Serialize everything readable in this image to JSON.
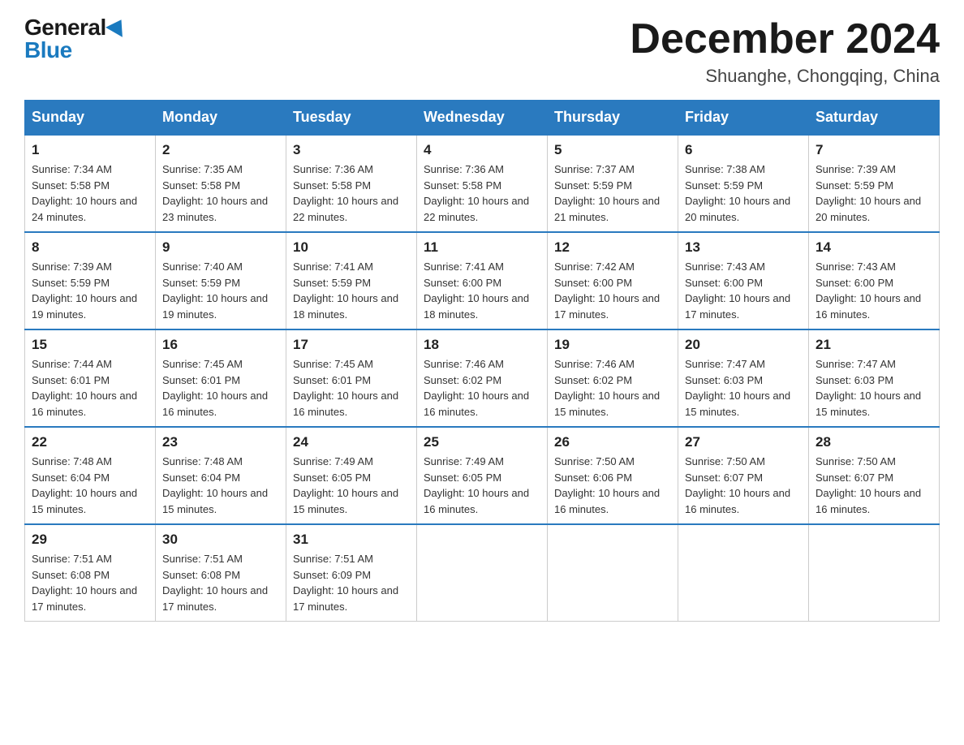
{
  "header": {
    "logo_general": "General",
    "logo_blue": "Blue",
    "month_title": "December 2024",
    "location": "Shuanghe, Chongqing, China"
  },
  "days_of_week": [
    "Sunday",
    "Monday",
    "Tuesday",
    "Wednesday",
    "Thursday",
    "Friday",
    "Saturday"
  ],
  "weeks": [
    [
      {
        "day": "1",
        "sunrise": "7:34 AM",
        "sunset": "5:58 PM",
        "daylight": "10 hours and 24 minutes."
      },
      {
        "day": "2",
        "sunrise": "7:35 AM",
        "sunset": "5:58 PM",
        "daylight": "10 hours and 23 minutes."
      },
      {
        "day": "3",
        "sunrise": "7:36 AM",
        "sunset": "5:58 PM",
        "daylight": "10 hours and 22 minutes."
      },
      {
        "day": "4",
        "sunrise": "7:36 AM",
        "sunset": "5:58 PM",
        "daylight": "10 hours and 22 minutes."
      },
      {
        "day": "5",
        "sunrise": "7:37 AM",
        "sunset": "5:59 PM",
        "daylight": "10 hours and 21 minutes."
      },
      {
        "day": "6",
        "sunrise": "7:38 AM",
        "sunset": "5:59 PM",
        "daylight": "10 hours and 20 minutes."
      },
      {
        "day": "7",
        "sunrise": "7:39 AM",
        "sunset": "5:59 PM",
        "daylight": "10 hours and 20 minutes."
      }
    ],
    [
      {
        "day": "8",
        "sunrise": "7:39 AM",
        "sunset": "5:59 PM",
        "daylight": "10 hours and 19 minutes."
      },
      {
        "day": "9",
        "sunrise": "7:40 AM",
        "sunset": "5:59 PM",
        "daylight": "10 hours and 19 minutes."
      },
      {
        "day": "10",
        "sunrise": "7:41 AM",
        "sunset": "5:59 PM",
        "daylight": "10 hours and 18 minutes."
      },
      {
        "day": "11",
        "sunrise": "7:41 AM",
        "sunset": "6:00 PM",
        "daylight": "10 hours and 18 minutes."
      },
      {
        "day": "12",
        "sunrise": "7:42 AM",
        "sunset": "6:00 PM",
        "daylight": "10 hours and 17 minutes."
      },
      {
        "day": "13",
        "sunrise": "7:43 AM",
        "sunset": "6:00 PM",
        "daylight": "10 hours and 17 minutes."
      },
      {
        "day": "14",
        "sunrise": "7:43 AM",
        "sunset": "6:00 PM",
        "daylight": "10 hours and 16 minutes."
      }
    ],
    [
      {
        "day": "15",
        "sunrise": "7:44 AM",
        "sunset": "6:01 PM",
        "daylight": "10 hours and 16 minutes."
      },
      {
        "day": "16",
        "sunrise": "7:45 AM",
        "sunset": "6:01 PM",
        "daylight": "10 hours and 16 minutes."
      },
      {
        "day": "17",
        "sunrise": "7:45 AM",
        "sunset": "6:01 PM",
        "daylight": "10 hours and 16 minutes."
      },
      {
        "day": "18",
        "sunrise": "7:46 AM",
        "sunset": "6:02 PM",
        "daylight": "10 hours and 16 minutes."
      },
      {
        "day": "19",
        "sunrise": "7:46 AM",
        "sunset": "6:02 PM",
        "daylight": "10 hours and 15 minutes."
      },
      {
        "day": "20",
        "sunrise": "7:47 AM",
        "sunset": "6:03 PM",
        "daylight": "10 hours and 15 minutes."
      },
      {
        "day": "21",
        "sunrise": "7:47 AM",
        "sunset": "6:03 PM",
        "daylight": "10 hours and 15 minutes."
      }
    ],
    [
      {
        "day": "22",
        "sunrise": "7:48 AM",
        "sunset": "6:04 PM",
        "daylight": "10 hours and 15 minutes."
      },
      {
        "day": "23",
        "sunrise": "7:48 AM",
        "sunset": "6:04 PM",
        "daylight": "10 hours and 15 minutes."
      },
      {
        "day": "24",
        "sunrise": "7:49 AM",
        "sunset": "6:05 PM",
        "daylight": "10 hours and 15 minutes."
      },
      {
        "day": "25",
        "sunrise": "7:49 AM",
        "sunset": "6:05 PM",
        "daylight": "10 hours and 16 minutes."
      },
      {
        "day": "26",
        "sunrise": "7:50 AM",
        "sunset": "6:06 PM",
        "daylight": "10 hours and 16 minutes."
      },
      {
        "day": "27",
        "sunrise": "7:50 AM",
        "sunset": "6:07 PM",
        "daylight": "10 hours and 16 minutes."
      },
      {
        "day": "28",
        "sunrise": "7:50 AM",
        "sunset": "6:07 PM",
        "daylight": "10 hours and 16 minutes."
      }
    ],
    [
      {
        "day": "29",
        "sunrise": "7:51 AM",
        "sunset": "6:08 PM",
        "daylight": "10 hours and 17 minutes."
      },
      {
        "day": "30",
        "sunrise": "7:51 AM",
        "sunset": "6:08 PM",
        "daylight": "10 hours and 17 minutes."
      },
      {
        "day": "31",
        "sunrise": "7:51 AM",
        "sunset": "6:09 PM",
        "daylight": "10 hours and 17 minutes."
      },
      null,
      null,
      null,
      null
    ]
  ]
}
